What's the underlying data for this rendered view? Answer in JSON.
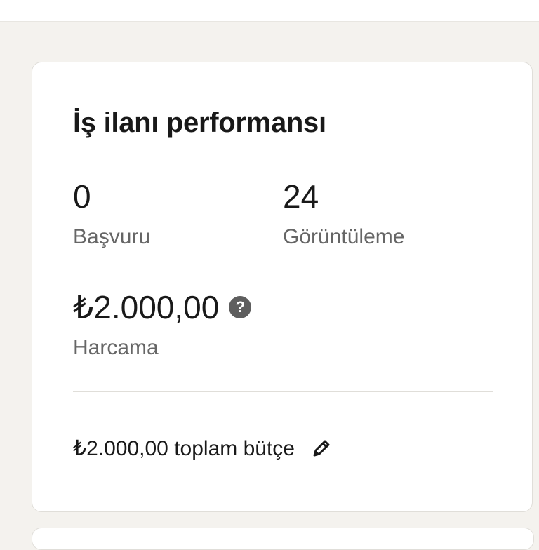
{
  "card": {
    "title": "İş ilanı performansı",
    "metrics": {
      "applications": {
        "value": "0",
        "label": "Başvuru"
      },
      "views": {
        "value": "24",
        "label": "Görüntüleme"
      },
      "spend": {
        "value": "₺2.000,00",
        "label": "Harcama",
        "icon": "help-icon"
      }
    },
    "budget": {
      "text": "₺2.000,00 toplam bütçe",
      "edit_icon": "pencil-icon"
    }
  },
  "colors": {
    "page_background": "#f4f2ee",
    "card_background": "#ffffff",
    "text_primary": "#191919",
    "text_secondary": "#666666",
    "icon": "#5e5e5e"
  }
}
